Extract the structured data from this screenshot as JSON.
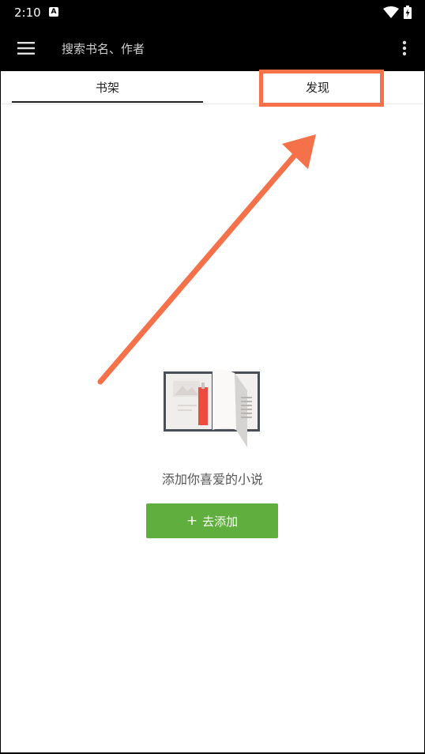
{
  "status_bar": {
    "time": "2:10",
    "notification_icon": "A",
    "icons": [
      "wifi-icon",
      "battery-charging-icon"
    ]
  },
  "toolbar": {
    "menu_icon": "hamburger-menu-icon",
    "search_placeholder": "搜索书名、作者",
    "more_icon": "more-vertical-icon"
  },
  "tabs": [
    {
      "label": "书架",
      "selected": true
    },
    {
      "label": "发现",
      "selected": false
    }
  ],
  "empty_state": {
    "illustration": "open-book-icon",
    "message": "添加你喜爱的小说",
    "button_label": "去添加",
    "button_icon": "plus"
  },
  "colors": {
    "annotation": "#f47149",
    "button": "#5fae3e",
    "toolbar": "#000000",
    "bookmark": "#ee4b3f"
  }
}
